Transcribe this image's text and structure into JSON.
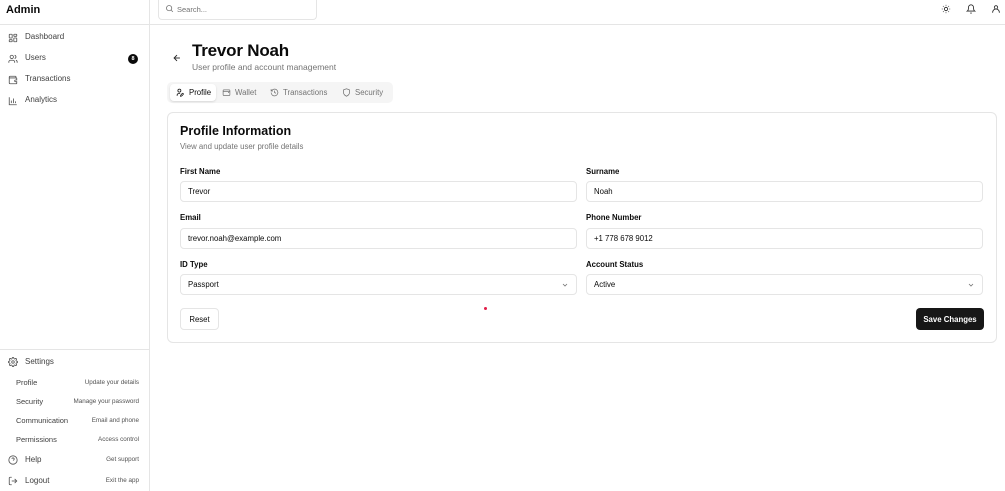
{
  "app": {
    "title": "Admin"
  },
  "sidebar": {
    "nav": [
      {
        "label": "Dashboard",
        "icon": "dashboard-icon"
      },
      {
        "label": "Users",
        "icon": "users-icon",
        "badge": "8"
      },
      {
        "label": "Transactions",
        "icon": "wallet-icon"
      },
      {
        "label": "Analytics",
        "icon": "bar-chart-icon"
      }
    ],
    "settings": {
      "label": "Settings",
      "items": [
        {
          "label": "Profile",
          "desc": "Update your details"
        },
        {
          "label": "Security",
          "desc": "Manage your password"
        },
        {
          "label": "Communication",
          "desc": "Email and phone"
        },
        {
          "label": "Permissions",
          "desc": "Access control"
        }
      ]
    },
    "help": {
      "label": "Help",
      "desc": "Get support"
    },
    "logout": {
      "label": "Logout",
      "desc": "Exit the app"
    }
  },
  "topbar": {
    "search_placeholder": "Search..."
  },
  "header": {
    "title": "Trevor Noah",
    "subtitle": "User profile and account management"
  },
  "tabs": [
    {
      "label": "Profile",
      "active": true
    },
    {
      "label": "Wallet"
    },
    {
      "label": "Transactions"
    },
    {
      "label": "Security"
    }
  ],
  "profile": {
    "title": "Profile Information",
    "description": "View and update user profile details",
    "fields": {
      "first_name": {
        "label": "First Name",
        "value": "Trevor"
      },
      "surname": {
        "label": "Surname",
        "value": "Noah"
      },
      "email": {
        "label": "Email",
        "value": "trevor.noah@example.com"
      },
      "phone": {
        "label": "Phone Number",
        "value": "+1 778 678 9012"
      },
      "id_type": {
        "label": "ID Type",
        "value": "Passport"
      },
      "account_status": {
        "label": "Account Status",
        "value": "Active"
      }
    },
    "reset_label": "Reset",
    "save_label": "Save Changes"
  },
  "colors": {
    "primary": "#171717",
    "border": "#e5e5e5",
    "muted": "#737373",
    "accent_dot": "#e11d48"
  }
}
